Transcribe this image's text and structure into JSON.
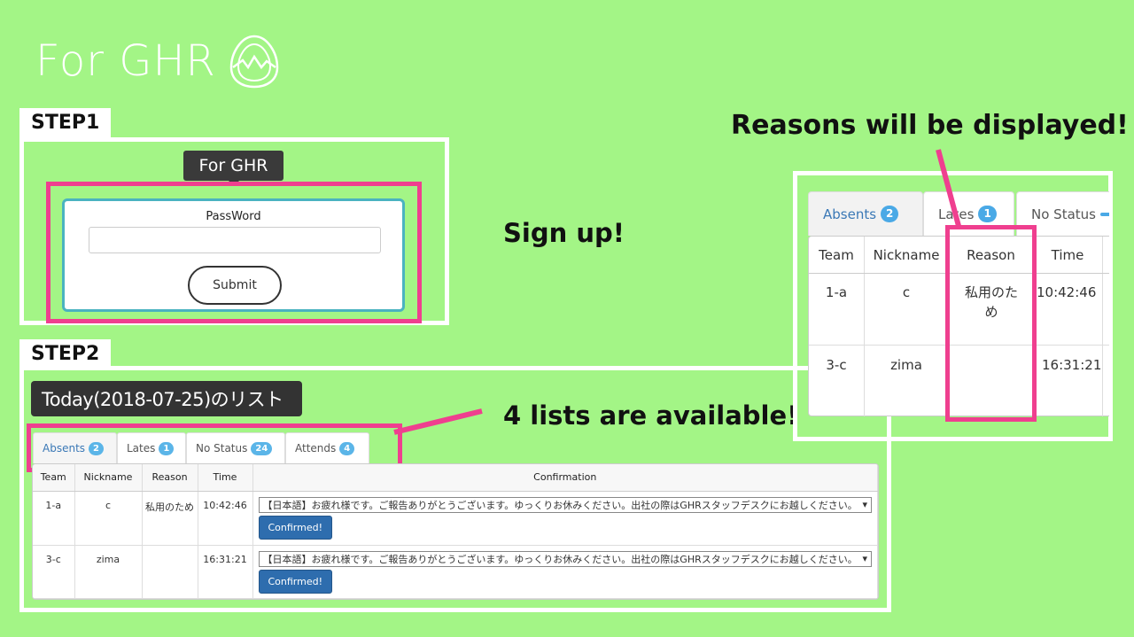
{
  "brand": {
    "text": "For GHR",
    "logo_icon": "egg-mountain-icon"
  },
  "step1": {
    "label": "STEP1",
    "tooltip": "For GHR",
    "password_label": "PassWord",
    "password_value": "",
    "submit_label": "Submit",
    "callout": "Sign up!"
  },
  "step2": {
    "label": "STEP2",
    "list_title": "Today(2018-07-25)のリスト",
    "callout": "4 lists are available!",
    "tabs": [
      {
        "label": "Absents",
        "count": "2"
      },
      {
        "label": "Lates",
        "count": "1"
      },
      {
        "label": "No Status",
        "count": "24"
      },
      {
        "label": "Attends",
        "count": "4"
      }
    ],
    "columns": [
      "Team",
      "Nickname",
      "Reason",
      "Time",
      "Confirmation"
    ],
    "rows": [
      {
        "team": "1-a",
        "nickname": "c",
        "reason": "私用のため",
        "time": "10:42:46",
        "message": "【日本語】お疲れ様です。ご報告ありがとうございます。ゆっくりお休みください。出社の際はGHRスタッフデスクにお越しください。",
        "button": "Confirmed!"
      },
      {
        "team": "3-c",
        "nickname": "zima",
        "reason": "",
        "time": "16:31:21",
        "message": "【日本語】お疲れ様です。ご報告ありがとうございます。ゆっくりお休みください。出社の際はGHRスタッフデスクにお越しください。",
        "button": "Confirmed!"
      }
    ]
  },
  "zoom": {
    "callout": "Reasons will be displayed!",
    "tabs": [
      {
        "label": "Absents",
        "count": "2"
      },
      {
        "label": "Lates",
        "count": "1"
      },
      {
        "label": "No Status",
        "count": ""
      }
    ],
    "columns": [
      "Team",
      "Nickname",
      "Reason",
      "Time"
    ],
    "rows": [
      {
        "team": "1-a",
        "nickname": "c",
        "reason": "私用のため",
        "time": "10:42:46"
      },
      {
        "team": "3-c",
        "nickname": "zima",
        "reason": "",
        "time": "16:31:21"
      }
    ]
  },
  "colors": {
    "background": "#a3f586",
    "highlight": "#ef3f8f",
    "badge": "#5bb5e8",
    "button": "#2e6dae"
  }
}
